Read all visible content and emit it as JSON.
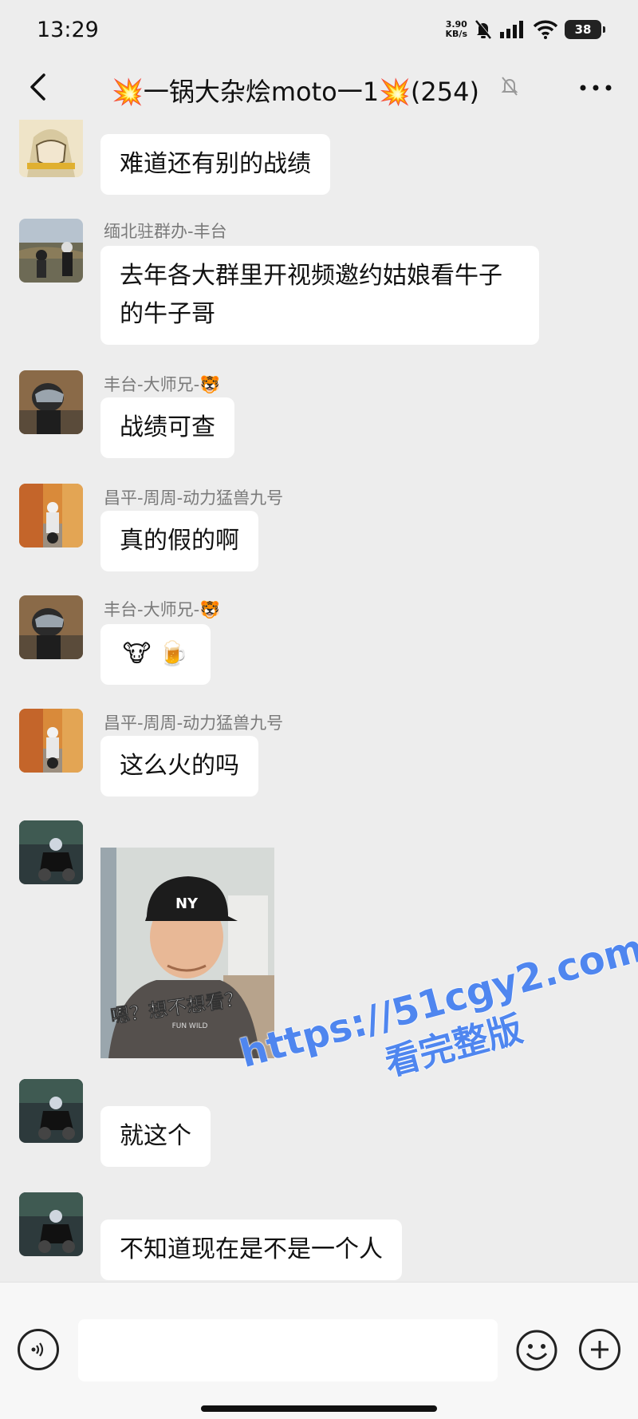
{
  "status_bar": {
    "time": "13:29",
    "net_speed_value": "3.90",
    "net_speed_unit": "KB/s",
    "battery": "38"
  },
  "header": {
    "title": "💥一锅大杂烩moto一1💥(254)"
  },
  "messages": [
    {
      "sender": "",
      "text": "难道还有别的战绩",
      "avatar": "avatar-cartoon"
    },
    {
      "sender": "缅北驻群办-丰台",
      "text": "去年各大群里开视频邀约姑娘看牛子的牛子哥",
      "avatar": "avatar-bikers"
    },
    {
      "sender": "丰台-大师兄-🐯",
      "text": "战绩可查",
      "avatar": "avatar-helmet"
    },
    {
      "sender": "昌平-周周-动力猛兽九号",
      "text": "真的假的啊",
      "avatar": "avatar-autumn-bike"
    },
    {
      "sender": "丰台-大师兄-🐯",
      "text": "🐮 🍺",
      "avatar": "avatar-helmet"
    },
    {
      "sender": "昌平-周周-动力猛兽九号",
      "text": "这么火的吗",
      "avatar": "avatar-autumn-bike"
    },
    {
      "sender": "",
      "image_caption": "嗯？想不想看？",
      "cap_text": "NY",
      "shirt_text": "FUN WILD",
      "avatar": "avatar-night-bike"
    },
    {
      "sender": "",
      "text": "就这个",
      "avatar": "avatar-night-bike"
    },
    {
      "sender": "",
      "text": "不知道现在是不是一个人",
      "avatar": "avatar-night-bike"
    }
  ],
  "watermark": {
    "line1": "https://51cgy2.com",
    "line2": "看完整版"
  },
  "input_bar": {
    "placeholder": ""
  },
  "colors": {
    "background": "#ededed",
    "bubble": "#ffffff",
    "watermark": "#4f86ef"
  }
}
